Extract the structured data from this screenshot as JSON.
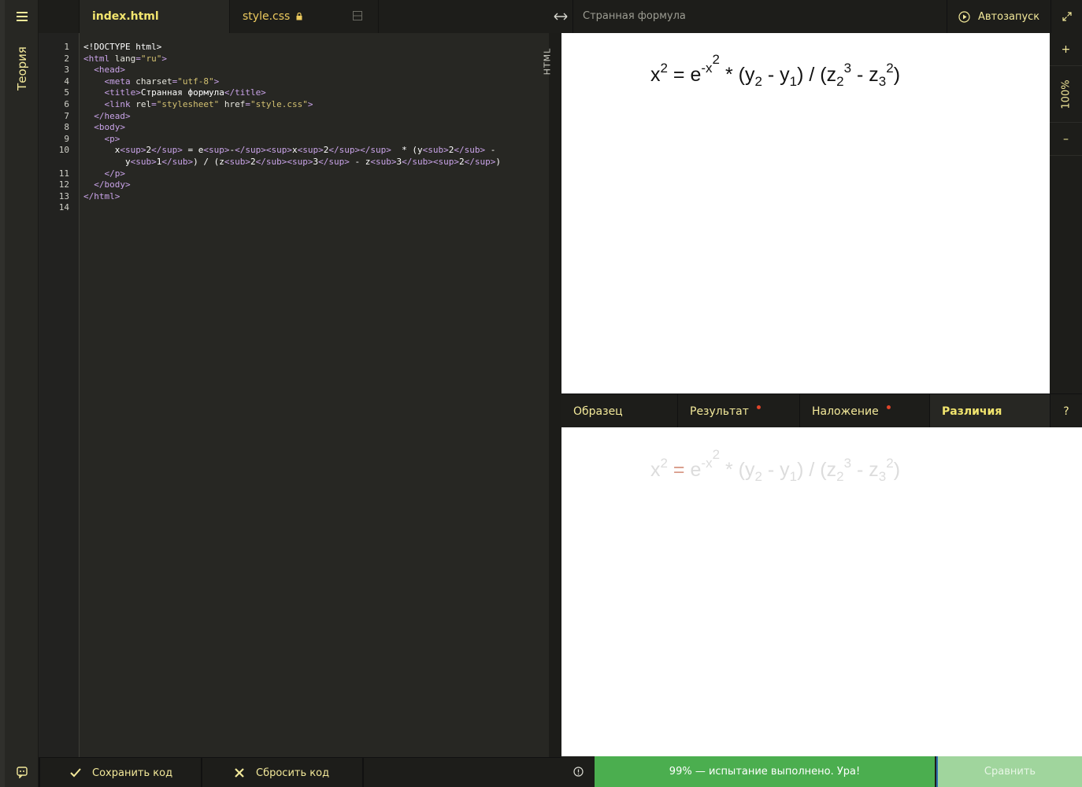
{
  "rail": {
    "theory_label": "Теория"
  },
  "tabs": [
    {
      "label": "index.html"
    },
    {
      "label": "style.css"
    }
  ],
  "editor": {
    "mode_label": "HTML",
    "line_numbers": [
      "1",
      "2",
      "3",
      "4",
      "5",
      "6",
      "7",
      "8",
      "9",
      "10",
      "11",
      "12",
      "13",
      "14"
    ]
  },
  "bottom_bar": {
    "save_label": "Сохранить код",
    "reset_label": "Сбросить код"
  },
  "preview": {
    "title": "Странная формула",
    "autorun_label": "Автозапуск",
    "zoom_in": "+",
    "zoom_level": "100%",
    "zoom_out": "–"
  },
  "compare_tabs": {
    "sample": "Образец",
    "result": "Результат",
    "overlay": "Наложение",
    "diff": "Различия",
    "help": "?"
  },
  "status": {
    "message": "99% — испытание выполнено. Ура!",
    "compare_label": "Сравнить"
  },
  "colors": {
    "accent_yellow": "#f3e99a",
    "success_green": "#4bae4f",
    "compare_green": "#a0d59d",
    "error_dot": "#e0452a"
  }
}
